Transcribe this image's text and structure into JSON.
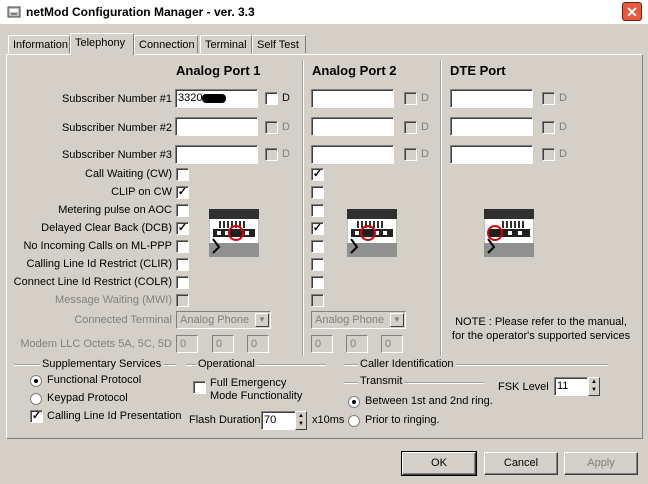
{
  "window": {
    "title": "netMod Configuration Manager  -  ver. 3.3",
    "close_label": "✕"
  },
  "tabs": [
    {
      "label": "Information",
      "active": false
    },
    {
      "label": "Telephony",
      "active": true
    },
    {
      "label": "Connection",
      "active": false
    },
    {
      "label": "Terminal",
      "active": false
    },
    {
      "label": "Self Test",
      "active": false
    }
  ],
  "ports": {
    "analog1": "Analog Port 1",
    "analog2": "Analog Port 2",
    "dte": "DTE Port"
  },
  "subscriber_labels": [
    "Subscriber Number #1",
    "Subscriber Number #2",
    "Subscriber Number #3"
  ],
  "subscriber_values": {
    "port1": [
      "3320",
      "",
      ""
    ],
    "port2": [
      "",
      "",
      ""
    ],
    "dte": [
      "",
      "",
      ""
    ]
  },
  "d_label": "D",
  "feature_labels": [
    "Call Waiting (CW)",
    "CLIP on CW",
    "Metering pulse on AOC",
    "Delayed Clear Back (DCB)",
    "No Incoming Calls on ML-PPP",
    "Calling Line Id Restrict (CLIR)",
    "Connect Line Id Restrict (COLR)",
    "Message Waiting (MWI)"
  ],
  "feature_checks": {
    "port1": [
      false,
      true,
      false,
      true,
      false,
      false,
      false,
      false
    ],
    "port2": [
      true,
      false,
      false,
      true,
      false,
      false,
      false,
      false
    ]
  },
  "check_mark": "✓",
  "connected_terminal": {
    "label": "Connected Terminal",
    "port1_value": "Analog Phone",
    "port2_value": "Analog Phone",
    "arrow": "▼"
  },
  "modem_llc": {
    "label": "Modem LLC Octets 5A, 5C, 5D",
    "port1": [
      "0",
      "0",
      "0"
    ],
    "port2": [
      "0",
      "0",
      "0"
    ]
  },
  "note": {
    "line1": "NOTE : Please refer to the manual,",
    "line2": "for the operator's supported services"
  },
  "supplementary": {
    "title": "Supplementary Services",
    "functional": "Functional Protocol",
    "keypad": "Keypad Protocol",
    "clip": "Calling Line Id Presentation",
    "selected": "functional",
    "clip_checked": true
  },
  "operational": {
    "title": "Operational",
    "emergency_line1": "Full Emergency",
    "emergency_line2": "Mode Functionality",
    "flash_label": "Flash Duration",
    "flash_value": "70",
    "flash_unit": "x10ms"
  },
  "caller_id": {
    "title": "Caller Identification",
    "transmit_title": "Transmit",
    "between": "Between 1st and 2nd ring.",
    "prior": "Prior to ringing.",
    "selected": "between",
    "fsk_label": "FSK Level",
    "fsk_value": "11"
  },
  "buttons": {
    "ok": "OK",
    "cancel": "Cancel",
    "apply": "Apply"
  }
}
